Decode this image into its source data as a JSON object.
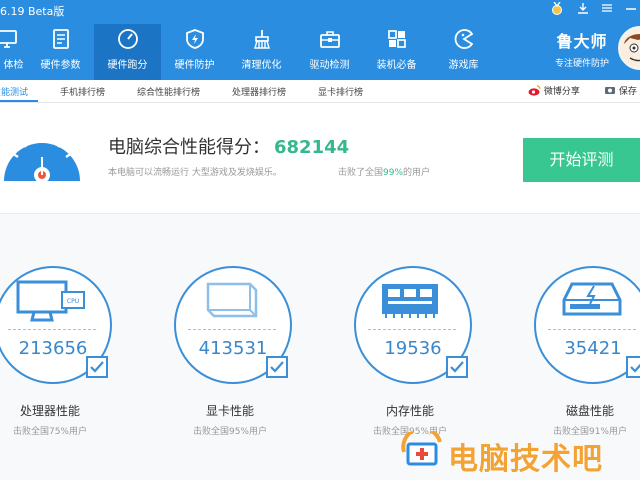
{
  "window": {
    "title": "6.19 Beta版",
    "controls": [
      "medal-icon",
      "menu-icon",
      "download-icon",
      "minimize-icon"
    ]
  },
  "nav": [
    {
      "label": "体检",
      "icon": "monitor-icon"
    },
    {
      "label": "硬件参数",
      "icon": "document-icon"
    },
    {
      "label": "硬件跑分",
      "icon": "speedometer-icon",
      "active": true
    },
    {
      "label": "硬件防护",
      "icon": "shield-bolt-icon"
    },
    {
      "label": "清理优化",
      "icon": "broom-icon"
    },
    {
      "label": "驱动检测",
      "icon": "toolbox-icon"
    },
    {
      "label": "装机必备",
      "icon": "apps-grid-icon"
    },
    {
      "label": "游戏库",
      "icon": "pacman-icon"
    }
  ],
  "brand": {
    "name": "鲁大师",
    "slogan": "专注硬件防护"
  },
  "subtabs": [
    "性能测试",
    "手机排行榜",
    "综合性能排行榜",
    "处理器排行榜",
    "显卡排行榜"
  ],
  "share": {
    "weibo": "微博分享",
    "save": "保存"
  },
  "score": {
    "title": "电脑综合性能得分：",
    "value": "682144",
    "desc": "本电脑可以流畅运行 大型游戏及发烧娱乐。",
    "beat_prefix": "击败了全国",
    "beat_pct": "99%",
    "beat_suffix": "的用户",
    "start_button": "开始评测"
  },
  "cards": [
    {
      "value": "213656",
      "name": "处理器性能",
      "sub": "击败全国75%用户"
    },
    {
      "value": "413531",
      "name": "显卡性能",
      "sub": "击败全国95%用户"
    },
    {
      "value": "19536",
      "name": "内存性能",
      "sub": "击败全国95%用户"
    },
    {
      "value": "35421",
      "name": "磁盘性能",
      "sub": "击败全国91%用户"
    }
  ],
  "watermark": {
    "text": "电脑技术吧"
  },
  "colors": {
    "primary": "#2a8de0",
    "green": "#38c791",
    "score": "#35b88f",
    "watermark": "#f3a234"
  }
}
